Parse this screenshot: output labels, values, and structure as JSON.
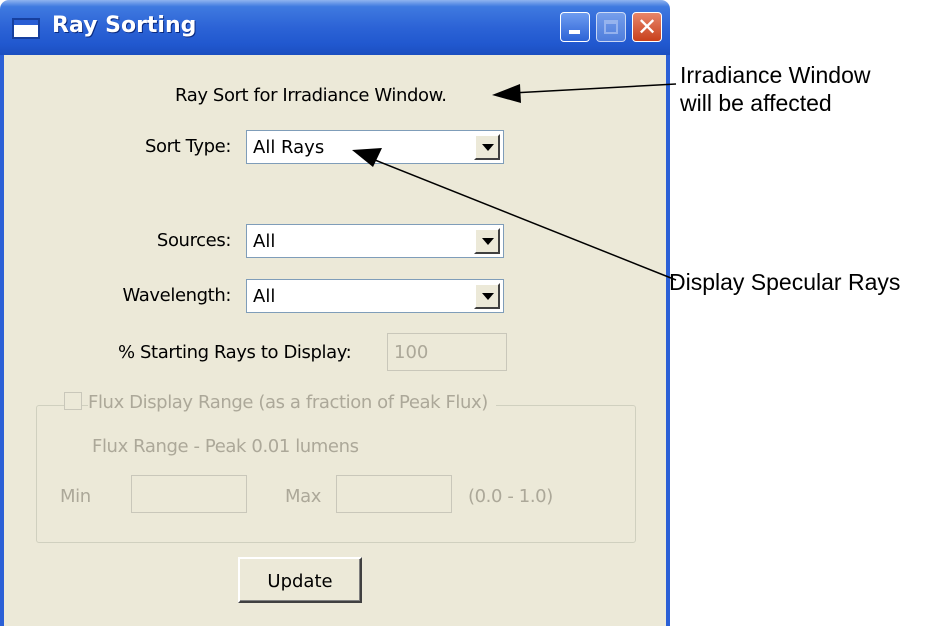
{
  "window": {
    "title": "Ray Sorting",
    "controls": {
      "close_glyph": "✕"
    }
  },
  "dialog": {
    "heading": "Ray Sort for Irradiance Window.",
    "sort_type": {
      "label": "Sort Type:",
      "value": "All Rays"
    },
    "sources": {
      "label": "Sources:",
      "value": "All"
    },
    "wavelength": {
      "label": "Wavelength:",
      "value": "All"
    },
    "starting_rays": {
      "label": "% Starting Rays to Display:",
      "value": "100"
    },
    "flux_group": {
      "checkbox_label": "Flux Display Range (as a fraction of Peak Flux)",
      "checked": false,
      "flux_range_text": "Flux Range - Peak 0.01 lumens",
      "min_label": "Min",
      "max_label": "Max",
      "range_hint": "(0.0 - 1.0)",
      "min_value": "",
      "max_value": ""
    },
    "update_button": "Update"
  },
  "annotations": {
    "irradiance_line1": "Irradiance Window",
    "irradiance_line2": "will be affected",
    "specular": "Display Specular Rays"
  },
  "colors": {
    "title_bar": "#2158cf",
    "dialog_bg": "#ece9d8",
    "disabled_text": "#aca899"
  }
}
